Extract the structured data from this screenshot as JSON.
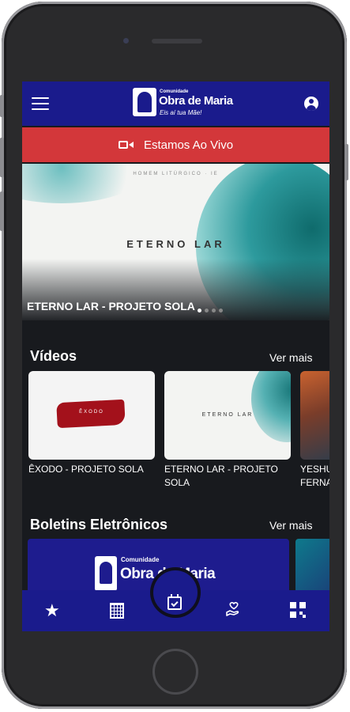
{
  "header": {
    "logo_small": "Comunidade",
    "logo_main": "Obra de Maria",
    "logo_tagline": "Eis aí tua Mãe!"
  },
  "live_banner": {
    "label": "Estamos Ao Vivo"
  },
  "hero": {
    "image_subtitle": "HOMEM LITÚRGICO · IE",
    "image_title": "ETERNO LAR",
    "caption": "ETERNO LAR - PROJETO SOLA",
    "slides": 4,
    "active_slide": 1
  },
  "videos": {
    "title": "Vídeos",
    "see_more": "Ver mais",
    "items": [
      {
        "thumb_text": "ÊXODO",
        "label": "ÊXODO - PROJETO SOLA"
      },
      {
        "thumb_text": "ETERNO LAR",
        "label": "ETERNO LAR - PROJETO SOLA"
      },
      {
        "label": "YESHU FERNA"
      }
    ]
  },
  "bulletins": {
    "title": "Boletins Eletrônicos",
    "see_more": "Ver mais",
    "card_small": "Comunidade",
    "card_main": "Obra de Maria"
  },
  "bottom_nav": {
    "items": [
      "star-icon",
      "building-icon",
      "calendar-check-icon",
      "hand-heart-icon",
      "qr-code-icon"
    ],
    "active": "calendar-check-icon"
  },
  "colors": {
    "primary": "#1a1b8c",
    "live": "#d3373a",
    "background": "#181a1e"
  }
}
